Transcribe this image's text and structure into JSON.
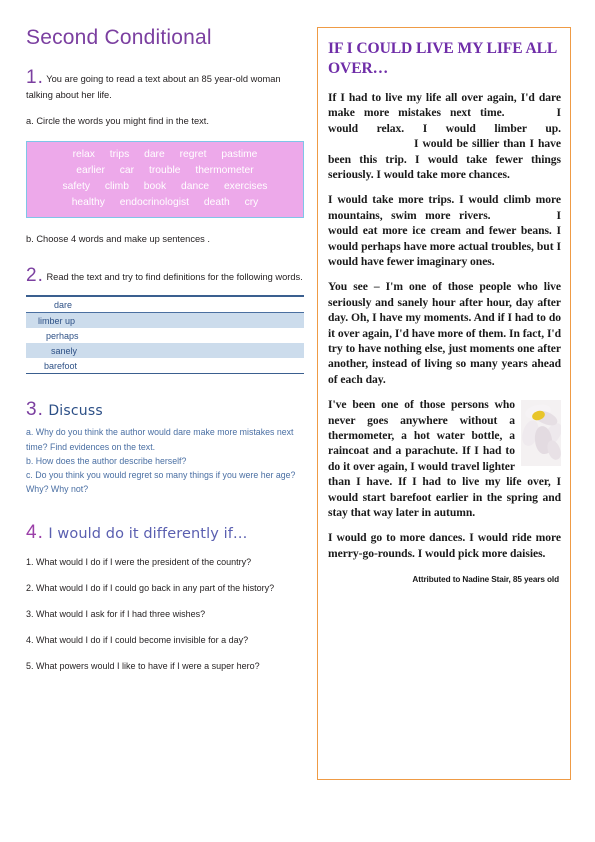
{
  "worksheet": {
    "title": "Second Conditional"
  },
  "task1": {
    "number": "1.",
    "instruction": "You are going to read a text about an 85 year-old woman talking about her life.",
    "sub_a": "a. Circle the words you might find in the text.",
    "sub_b": "b. Choose 4 words and make up  sentences .",
    "word_bank": [
      [
        "relax",
        "trips",
        "dare",
        "regret",
        "pastime"
      ],
      [
        "earlier",
        "car",
        "trouble",
        "thermometer"
      ],
      [
        "safety",
        "climb",
        "book",
        "dance",
        "exercises"
      ],
      [
        "healthy",
        "endocrinologist",
        "death",
        "cry"
      ]
    ]
  },
  "task2": {
    "number": "2.",
    "instruction": "Read the text and try to find definitions for the following words.",
    "words": [
      "dare",
      "limber up",
      "perhaps",
      "sanely",
      "barefoot"
    ]
  },
  "task3": {
    "number": "3.",
    "heading": "Discuss",
    "questions": [
      "a. Why do you think the author would dare make more mistakes next time? Find evidences on the text.",
      "b. How does the author describe herself?",
      "c. Do you think you would regret so many things if you were her age? Why? Why not?"
    ]
  },
  "task4": {
    "number": "4.",
    "heading": "I would do it differently if…",
    "questions": [
      "1. What would I do if I were the president of the country?",
      "2. What would I do if I could go back in any part of the history?",
      "3. What would I ask for if I had three wishes?",
      "4. What would I do if I could become invisible for a day?",
      "5. What powers would I like to have if I were a super hero?"
    ]
  },
  "reading": {
    "title": "IF I COULD LIVE MY LIFE ALL OVER…",
    "paragraph1_a": "If I had to live my life all over again, I'd dare make more mistakes next time.",
    "paragraph1_b": "I would relax. I would limber up.",
    "paragraph1_c": "I would be sillier than I have been this trip. I would take fewer things seriously. I would take more chances.",
    "paragraph2_a": "I would take more trips. I would climb more mountains, swim more rivers.",
    "paragraph2_b": "I would eat more ice cream and fewer beans. I would perhaps have more actual troubles, but I would have fewer imaginary ones.",
    "paragraph3": "You see – I'm one of those people who live seriously and sanely hour after hour, day after day. Oh, I have my moments. And if I had to do it over again, I'd have more of them. In fact, I'd try to have nothing else, just moments one after another, instead of living so many years ahead of each day.",
    "paragraph4": "I've been one of those persons who never goes anywhere without a thermometer, a hot water bottle, a raincoat and a parachute. If I had to do it over again, I would travel lighter than I have. If I had to live my life over, I would start barefoot earlier in the spring and stay that way later in autumn.",
    "paragraph5": "I would go to more dances. I would ride more merry-go-rounds. I would pick more daisies.",
    "attribution": "Attributed to Nadine Stair, 85 years old",
    "image_caption": "daisy-flower-photo"
  },
  "colors": {
    "title_purple": "#7b3fa0",
    "word_bank_bg": "#eda9ea",
    "word_bank_border": "#7fc5e8",
    "table_blue": "#3a5f8f",
    "table_shade": "#ccdcec",
    "panel_border_orange": "#ef9b45",
    "reading_title_purple": "#6f2da8",
    "discuss_blue": "#4a6fa3",
    "task4_blue": "#5a5fb0"
  }
}
